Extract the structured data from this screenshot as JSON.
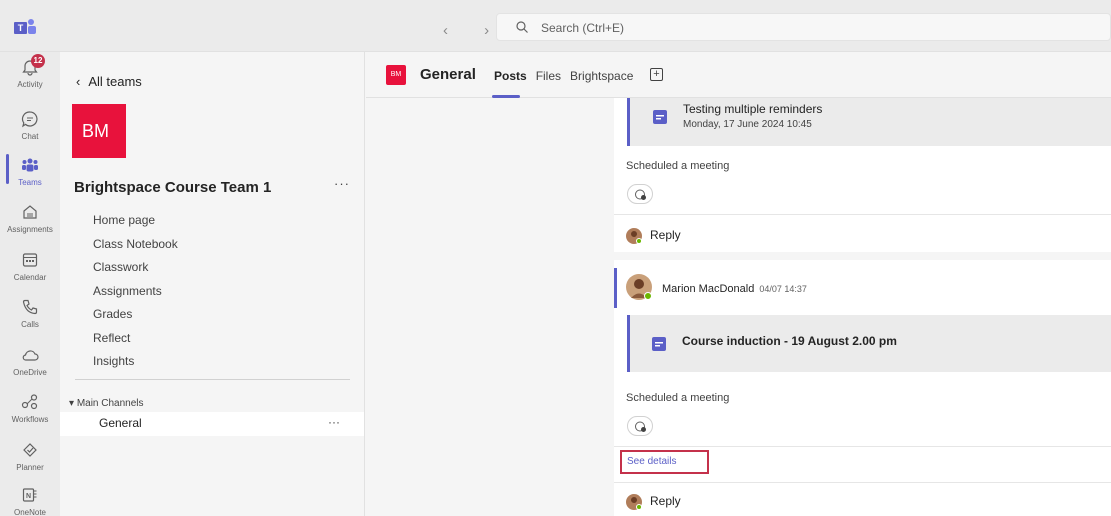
{
  "search": {
    "placeholder": "Search (Ctrl+E)"
  },
  "nav": {
    "back_forward": "‹ ›"
  },
  "rail": {
    "items": [
      {
        "label": "Activity",
        "icon": "bell-icon",
        "badge": "12"
      },
      {
        "label": "Chat",
        "icon": "chat-icon"
      },
      {
        "label": "Teams",
        "icon": "teams-icon"
      },
      {
        "label": "Assignments",
        "icon": "assignments-icon"
      },
      {
        "label": "Calendar",
        "icon": "calendar-icon"
      },
      {
        "label": "Calls",
        "icon": "phone-icon"
      },
      {
        "label": "OneDrive",
        "icon": "cloud-icon"
      },
      {
        "label": "Workflows",
        "icon": "workflows-icon"
      },
      {
        "label": "Planner",
        "icon": "planner-icon"
      },
      {
        "label": "OneNote",
        "icon": "onenote-icon"
      }
    ]
  },
  "teampanel": {
    "back_label": "All teams",
    "avatar_text": "BM",
    "team_name": "Brightspace Course Team 1",
    "more": "···",
    "tabs": [
      "Home page",
      "Class Notebook",
      "Classwork",
      "Assignments",
      "Grades",
      "Reflect",
      "Insights"
    ],
    "channels_header": "Main Channels",
    "channel": "General",
    "channel_more": "···"
  },
  "main": {
    "avatar_text": "BM",
    "title": "General",
    "tabs": [
      "Posts",
      "Files",
      "Brightspace"
    ],
    "add_tab": "+"
  },
  "post1": {
    "card_title": "Testing multiple reminders",
    "card_date": "Monday, 17 June 2024 10:45",
    "scheduled": "Scheduled a meeting",
    "reply": "Reply"
  },
  "post2": {
    "author": "Marion MacDonald",
    "time": "04/07 14:37",
    "card_title": "Course induction - 19 August 2.00 pm",
    "scheduled": "Scheduled a meeting",
    "see_details": "See details",
    "reply": "Reply"
  },
  "colors": {
    "accent": "#5b5fc7",
    "team": "#e8123c",
    "highlight": "#c4314b"
  }
}
